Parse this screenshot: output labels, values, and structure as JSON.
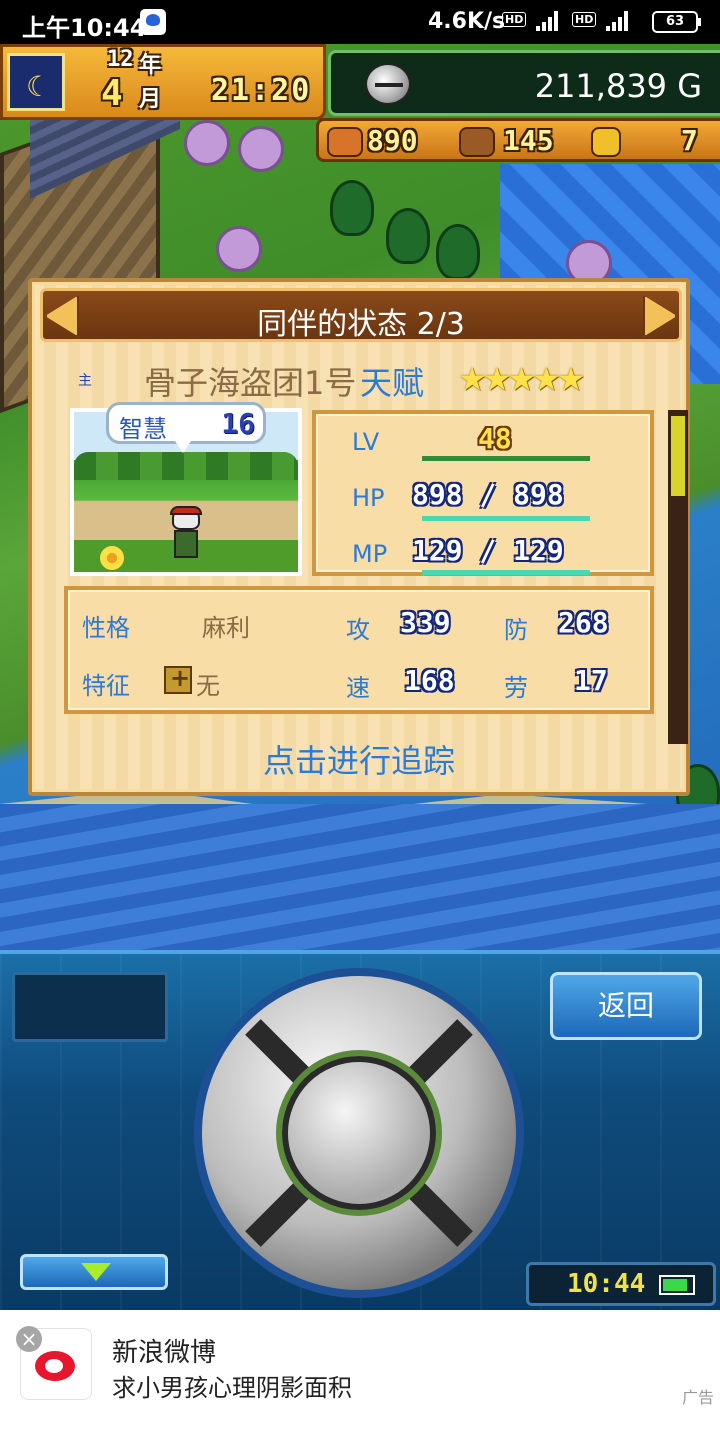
{
  "statusbar": {
    "time": "上午10:44",
    "net_speed": "4.6K/s",
    "hd1": "HD",
    "hd2": "HD",
    "battery": "63"
  },
  "hud": {
    "year": "12",
    "year_unit": "年",
    "month": "4",
    "month_unit": "月",
    "clock": "21:20",
    "gold": "211,839 G",
    "food": "890",
    "wood": "145",
    "medals": "7"
  },
  "panel": {
    "title": "同伴的状态 2/3",
    "master_mark": "主",
    "name": "骨子海盗团1号",
    "talent_label": "天赋",
    "stars": "★★★★★",
    "wisdom_label": "智慧",
    "wisdom_value": "16",
    "lv_label": "LV",
    "lv_value": "48",
    "hp_label": "HP",
    "hp_value": "898 / 898",
    "hp_fill": 1.0,
    "mp_label": "MP",
    "mp_value": "129 / 129",
    "mp_fill": 1.0,
    "personality_label": "性格",
    "personality_value": "麻利",
    "trait_label": "特征",
    "trait_value": "无",
    "atk_label": "攻",
    "atk_value": "339",
    "def_label": "防",
    "def_value": "268",
    "spd_label": "速",
    "spd_value": "168",
    "fatigue_label": "劳",
    "fatigue_value": "17",
    "track_link": "点击进行追踪"
  },
  "controller": {
    "back_label": "返回",
    "clock": "10:44"
  },
  "ad": {
    "close": "×",
    "title": "新浪微博",
    "subtitle": "求小男孩心理阴影面积",
    "tag": "广告"
  },
  "colors": {
    "accent_blue": "#2a7ad8",
    "panel_brown": "#8b4a1a",
    "hp_bar": "#4ad8b0",
    "lv_bar": "#2f8a3a"
  }
}
